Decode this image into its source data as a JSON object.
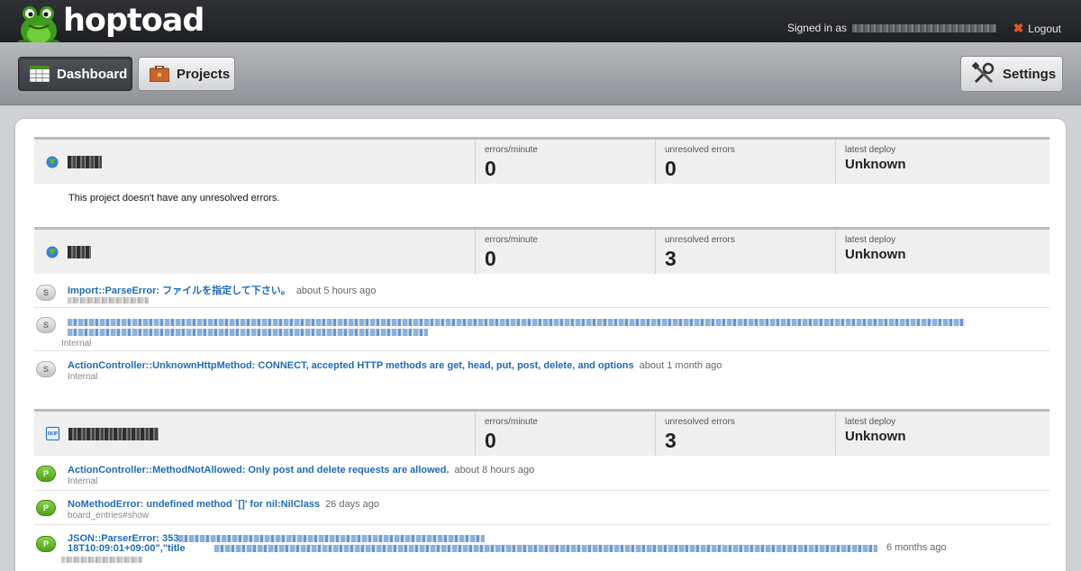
{
  "app": {
    "name": "hoptoad"
  },
  "header": {
    "signed_in_label": "Signed in as",
    "logout_label": "Logout"
  },
  "nav": {
    "dashboard_label": "Dashboard",
    "projects_label": "Projects",
    "settings_label": "Settings"
  },
  "stat_labels": {
    "errors_per_minute": "errors/minute",
    "unresolved": "unresolved errors",
    "latest_deploy": "latest deploy"
  },
  "projects": [
    {
      "icon": "globe-icon",
      "errors_per_minute": "0",
      "unresolved": "0",
      "latest_deploy": "Unknown",
      "empty_message": "This project doesn't have any unresolved errors."
    },
    {
      "icon": "globe-icon",
      "errors_per_minute": "0",
      "unresolved": "3",
      "latest_deploy": "Unknown",
      "errors": [
        {
          "badge": "S",
          "title": "Import::ParseError: ファイルを指定して下さい。",
          "age": "about 5 hours ago"
        },
        {
          "badge": "S",
          "subtitle": "Internal"
        },
        {
          "badge": "S",
          "title": "ActionController::UnknownHttpMethod: CONNECT, accepted HTTP methods are get, head, put, post, delete, and options",
          "age": "about 1 month ago",
          "subtitle": "Internal"
        }
      ]
    },
    {
      "icon": "skip-icon",
      "icon_text": "SKIP",
      "errors_per_minute": "0",
      "unresolved": "3",
      "latest_deploy": "Unknown",
      "errors": [
        {
          "badge": "P",
          "title": "ActionController::MethodNotAllowed: Only post and delete requests are allowed.",
          "age": "about 8 hours ago",
          "subtitle": "Internal"
        },
        {
          "badge": "P",
          "title": "NoMethodError: undefined method `[]' for nil:NilClass",
          "age": "26 days ago",
          "subtitle": "board_entries#show"
        },
        {
          "badge": "P",
          "title_line1": "JSON::ParserError: 353:",
          "title_line2_prefix": "18T10:09:01+09:00\",\"title",
          "age": "6 months ago"
        }
      ]
    }
  ]
}
